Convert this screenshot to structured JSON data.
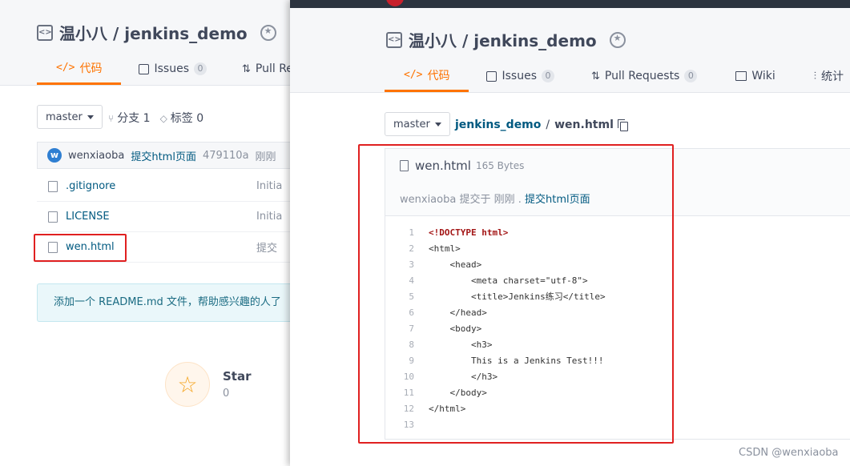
{
  "back": {
    "repo_owner_repo": "温小八 / jenkins_demo",
    "tabs": {
      "code": "代码",
      "issues": "Issues",
      "issues_count": "0",
      "pull_requests": "Pull Reques"
    },
    "branch": "master",
    "branch_count_label": "分支 1",
    "tag_count_label": "标签 0",
    "last_commit": {
      "avatar": "w",
      "author": "wenxiaoba",
      "message": "提交html页面",
      "sha": "479110a",
      "time": "刚刚"
    },
    "files": [
      {
        "name": ".gitignore",
        "commit": "Initia"
      },
      {
        "name": "LICENSE",
        "commit": "Initia"
      },
      {
        "name": "wen.html",
        "commit": "提交"
      }
    ],
    "readme_tip": "添加一个 README.md 文件，帮助感兴趣的人了",
    "star": {
      "label": "Star",
      "count": "0"
    }
  },
  "front": {
    "repo_owner_repo": "温小八 / jenkins_demo",
    "tabs": {
      "code": "代码",
      "issues": "Issues",
      "issues_count": "0",
      "pull_requests": "Pull Requests",
      "pull_requests_count": "0",
      "wiki": "Wiki",
      "stats": "统计"
    },
    "branch": "master",
    "breadcrumb": {
      "repo": "jenkins_demo",
      "sep": "/",
      "file": "wen.html"
    },
    "file": {
      "name": "wen.html",
      "size": "165 Bytes",
      "author": "wenxiaoba",
      "submitted_at": "提交于 刚刚 .",
      "commit_message": "提交html页面"
    },
    "code_lines": [
      {
        "n": "1",
        "text": "<!DOCTYPE html>"
      },
      {
        "n": "2",
        "text": "<html>"
      },
      {
        "n": "3",
        "text": "    <head>"
      },
      {
        "n": "4",
        "text": "        <meta charset=\"utf-8\">"
      },
      {
        "n": "5",
        "text": "        <title>Jenkins练习</title>"
      },
      {
        "n": "6",
        "text": "    </head>"
      },
      {
        "n": "7",
        "text": "    <body>"
      },
      {
        "n": "8",
        "text": "        <h3>"
      },
      {
        "n": "9",
        "text": "        This is a Jenkins Test!!!"
      },
      {
        "n": "10",
        "text": "        </h3>"
      },
      {
        "n": "11",
        "text": "    </body>"
      },
      {
        "n": "12",
        "text": "</html>"
      },
      {
        "n": "13",
        "text": ""
      }
    ]
  },
  "watermark": "CSDN @wenxiaoba",
  "colors": {
    "accent": "#fe7300",
    "link": "#005980",
    "highlight": "#e02020"
  },
  "icons": [
    "repo-icon",
    "award-icon",
    "code-icon",
    "issues-icon",
    "pull-request-icon",
    "wiki-icon",
    "stats-icon",
    "branch-icon",
    "tag-icon",
    "file-icon",
    "copy-icon",
    "star-icon"
  ]
}
